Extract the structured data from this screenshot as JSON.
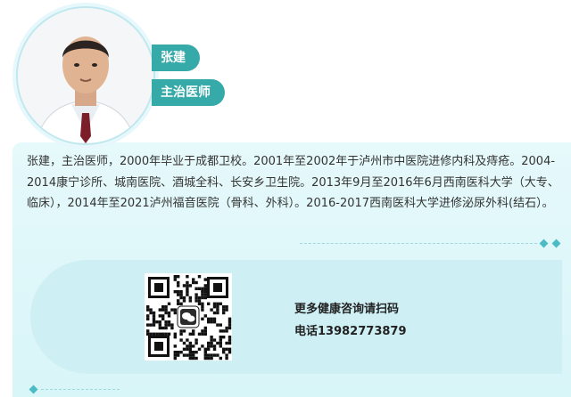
{
  "doctor": {
    "name": "张建",
    "title": "主治医师",
    "bio": "张建，主治医师，2000年毕业于成都卫校。2001年至2002年于泸州市中医院进修内科及痔疮。2004-2014康宁诊所、城南医院、酒城全科、长安乡卫生院。2013年9月至2016年6月西南医科大学（大专、临床），2014年至2021泸州福音医院（骨科、外科）。2016-2017西南医科大学进修泌尿外科(结石）。"
  },
  "contact": {
    "consult_text": "更多健康咨询请扫码",
    "phone_text": "电话13982773879"
  },
  "icons": {
    "qr": "wechat-qr-code-icon",
    "divider": "diamond-icon"
  },
  "colors": {
    "accent": "#36aaa8",
    "card_bg": "#e6f9fb",
    "panel_bg": "#cef0f5"
  }
}
